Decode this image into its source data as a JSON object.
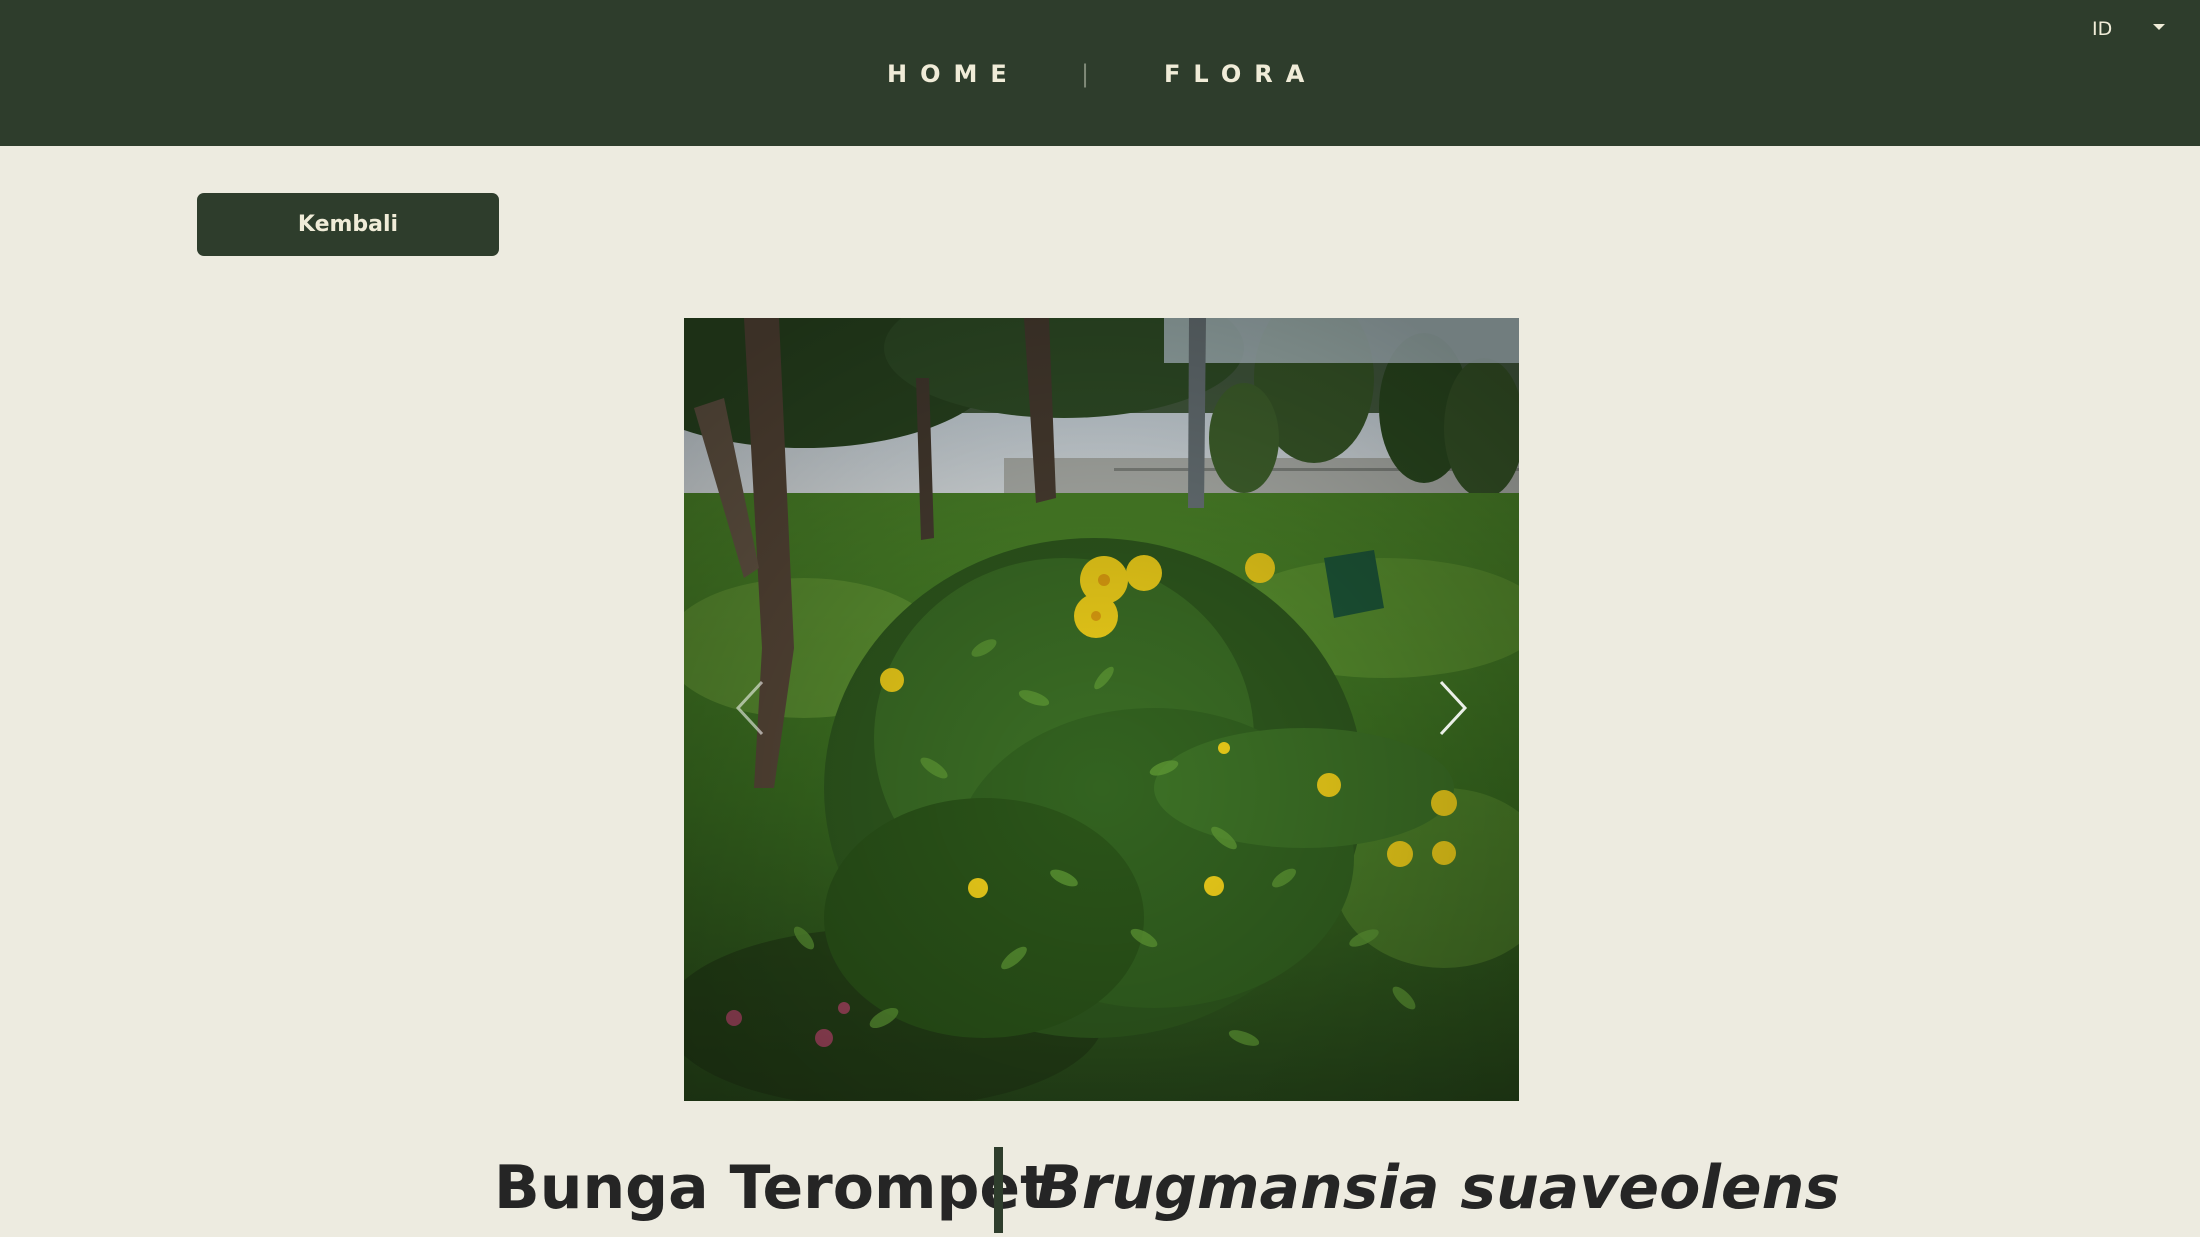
{
  "nav": {
    "home_label": "HOME",
    "separator": "|",
    "flora_label": "FLORA"
  },
  "language": {
    "selected": "ID",
    "icon": "caret-down-icon"
  },
  "back_button": {
    "label": "Kembali"
  },
  "carousel": {
    "prev_icon": "chevron-left-icon",
    "next_icon": "chevron-right-icon"
  },
  "plant": {
    "common_name": "Bunga Terompet",
    "scientific_name": "Brugmansia suaveolens"
  },
  "colors": {
    "header_bg": "#2e3d2c",
    "page_bg": "#edebe0",
    "button_bg": "#2e3d2c",
    "button_text": "#f0ecd8",
    "title_text": "#252525"
  }
}
